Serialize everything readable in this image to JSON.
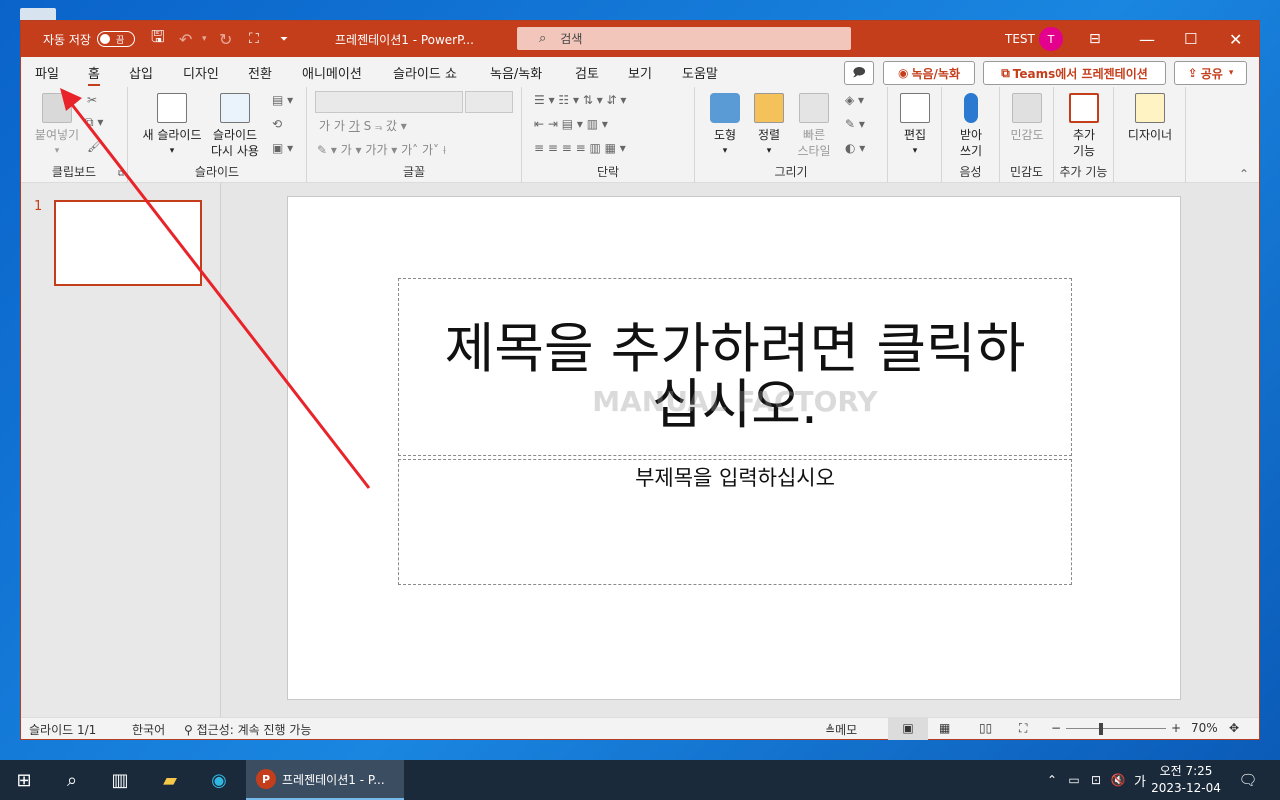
{
  "window": {
    "autosave_label": "자동 저장",
    "autosave_state": "끔",
    "title": "프레젠테이션1  -  PowerP...",
    "search_placeholder": "검색",
    "user_name": "TEST",
    "user_initial": "T"
  },
  "tabs": [
    {
      "label": "파일"
    },
    {
      "label": "홈"
    },
    {
      "label": "삽입"
    },
    {
      "label": "디자인"
    },
    {
      "label": "전환"
    },
    {
      "label": "애니메이션"
    },
    {
      "label": "슬라이드 쇼"
    },
    {
      "label": "녹음/녹화"
    },
    {
      "label": "검토"
    },
    {
      "label": "보기"
    },
    {
      "label": "도움말"
    }
  ],
  "tab_actions": {
    "record": "녹음/녹화",
    "teams": "Teams에서 프레젠테이션",
    "share": "공유"
  },
  "ribbon": {
    "clipboard": {
      "paste": "붙여넣기",
      "group": "클립보드"
    },
    "slides": {
      "new_slide": "새 슬라이드",
      "reuse_line1": "슬라이드",
      "reuse_line2": "다시 사용",
      "group": "슬라이드"
    },
    "font": {
      "group": "글꼴"
    },
    "paragraph": {
      "group": "단락"
    },
    "drawing": {
      "shapes": "도형",
      "arrange": "정렬",
      "quick_line1": "빠른",
      "quick_line2": "스타일",
      "group": "그리기"
    },
    "editing": {
      "label": "편집"
    },
    "voice": {
      "dictate_line1": "받아",
      "dictate_line2": "쓰기",
      "group": "음성"
    },
    "sensitivity": {
      "label": "민감도",
      "group": "민감도"
    },
    "addins": {
      "label_line1": "추가",
      "label_line2": "기능",
      "group": "추가 기능"
    },
    "designer": {
      "label": "디자이너"
    }
  },
  "thumbnail": {
    "number": "1"
  },
  "slide": {
    "title_line1": "제목을 추가하려면 클릭하",
    "title_line2": "십시오.",
    "subtitle": "부제목을 입력하십시오",
    "watermark": "MANUAL FACTORY"
  },
  "status": {
    "slide_count": "슬라이드 1/1",
    "language": "한국어",
    "accessibility": "접근성: 계속 진행 가능",
    "notes": "메모",
    "zoom": "70%"
  },
  "taskbar": {
    "app_label": "프레젠테이션1 - P...",
    "time": "오전 7:25",
    "date": "2023-12-04",
    "ime": "가"
  },
  "colors": {
    "accent": "#c43e1c",
    "annotation_arrow": "#e8232a",
    "avatar": "#e3008c"
  }
}
